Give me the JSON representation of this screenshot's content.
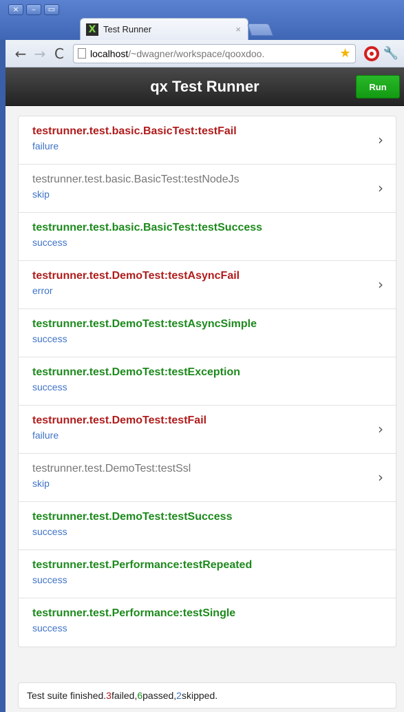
{
  "browser": {
    "tab_title": "Test Runner",
    "tab_favicon": "X",
    "url_host": "localhost",
    "url_path": "/~dwagner/workspace/qooxdoo.",
    "icons": {
      "close": "close-icon",
      "minimize": "minimize-icon",
      "maximize": "maximize-icon",
      "back": "back-arrow-icon",
      "forward": "forward-arrow-icon",
      "reload": "reload-icon",
      "bookmark": "star-icon",
      "extension": "opera-extension-icon",
      "menu": "wrench-icon"
    }
  },
  "app": {
    "title": "qx Test Runner",
    "run_label": "Run"
  },
  "colors": {
    "failure": "#b01c1c",
    "success": "#1d8a1d",
    "skip": "#777777",
    "status_link": "#3f73c7"
  },
  "tests": [
    {
      "name": "testrunner.test.basic.BasicTest:testFail",
      "status": "failure",
      "kind": "fail",
      "has_chevron": true
    },
    {
      "name": "testrunner.test.basic.BasicTest:testNodeJs",
      "status": "skip",
      "kind": "skip",
      "has_chevron": true
    },
    {
      "name": "testrunner.test.basic.BasicTest:testSuccess",
      "status": "success",
      "kind": "success",
      "has_chevron": false
    },
    {
      "name": "testrunner.test.DemoTest:testAsyncFail",
      "status": "error",
      "kind": "fail",
      "has_chevron": true
    },
    {
      "name": "testrunner.test.DemoTest:testAsyncSimple",
      "status": "success",
      "kind": "success",
      "has_chevron": false
    },
    {
      "name": "testrunner.test.DemoTest:testException",
      "status": "success",
      "kind": "success",
      "has_chevron": false
    },
    {
      "name": "testrunner.test.DemoTest:testFail",
      "status": "failure",
      "kind": "fail",
      "has_chevron": true
    },
    {
      "name": "testrunner.test.DemoTest:testSsl",
      "status": "skip",
      "kind": "skip",
      "has_chevron": true
    },
    {
      "name": "testrunner.test.DemoTest:testSuccess",
      "status": "success",
      "kind": "success",
      "has_chevron": false
    },
    {
      "name": "testrunner.test.Performance:testRepeated",
      "status": "success",
      "kind": "success",
      "has_chevron": false
    },
    {
      "name": "testrunner.test.Performance:testSingle",
      "status": "success",
      "kind": "success",
      "has_chevron": false
    }
  ],
  "summary": {
    "prefix": "Test suite finished. ",
    "failed_count": "3",
    "failed_label": " failed, ",
    "passed_count": "6",
    "passed_label": " passed, ",
    "skipped_count": "2",
    "skipped_label": " skipped."
  }
}
